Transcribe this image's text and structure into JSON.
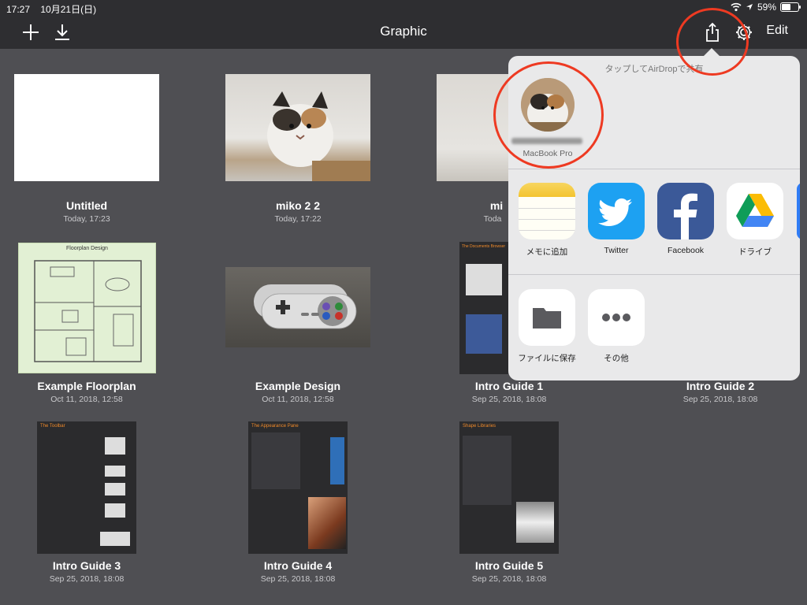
{
  "status_bar": {
    "time": "17:27",
    "date": "10月21日(日)",
    "battery": "59%",
    "battery_level": 0.59
  },
  "nav": {
    "title": "Graphic",
    "add_icon": "plus-icon",
    "import_icon": "download-icon",
    "share_icon": "share-icon",
    "settings_icon": "gear-icon",
    "edit_label": "Edit"
  },
  "documents": [
    {
      "title": "Untitled",
      "date": "Today, 17:23"
    },
    {
      "title": "miko 2 2",
      "date": "Today, 17:22"
    },
    {
      "title": "mi",
      "date": "Toda"
    },
    {
      "title": "Example Floorplan",
      "date": "Oct 11, 2018, 12:58",
      "thumb_heading": "Floorplan Design"
    },
    {
      "title": "Example Design",
      "date": "Oct 11, 2018, 12:58"
    },
    {
      "title": "Intro Guide 1",
      "date": "Sep 25, 2018, 18:08",
      "thumb_heading": "The Documents Browser"
    },
    {
      "title": "Intro Guide 2",
      "date": "Sep 25, 2018, 18:08"
    },
    {
      "title": "Intro Guide 3",
      "date": "Sep 25, 2018, 18:08",
      "thumb_heading": "The Toolbar"
    },
    {
      "title": "Intro Guide 4",
      "date": "Sep 25, 2018, 18:08",
      "thumb_heading": "The Appearance Pane"
    },
    {
      "title": "Intro Guide 5",
      "date": "Sep 25, 2018, 18:08",
      "thumb_heading": "Shape Libraries"
    }
  ],
  "share_sheet": {
    "airdrop_hint": "タップしてAirDropで共有",
    "airdrop_device": "MacBook Pro",
    "apps": [
      {
        "label": "メモに追加",
        "icon": "notes-icon"
      },
      {
        "label": "Twitter",
        "icon": "twitter-icon"
      },
      {
        "label": "Facebook",
        "icon": "facebook-icon"
      },
      {
        "label": "ドライブ",
        "icon": "google-drive-icon"
      }
    ],
    "actions": [
      {
        "label": "ファイルに保存",
        "icon": "folder-icon"
      },
      {
        "label": "その他",
        "icon": "more-icon"
      }
    ]
  },
  "colors": {
    "annotation": "#ee3a22",
    "twitter": "#1da1f2",
    "facebook": "#3b5998",
    "background": "#4f4f53"
  }
}
